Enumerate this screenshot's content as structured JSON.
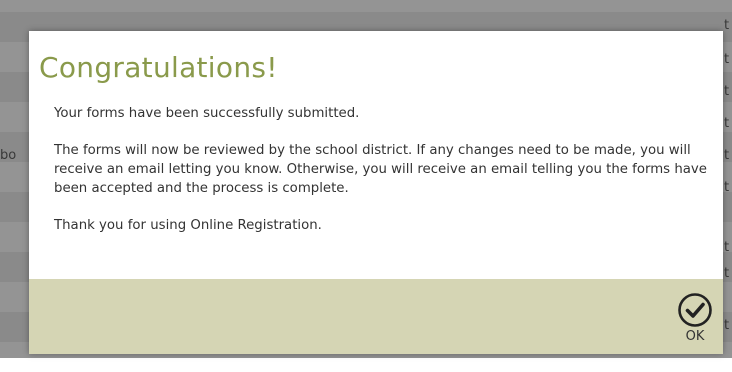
{
  "dialog": {
    "title": "Congratulations!",
    "paragraphs": [
      "Your forms have been successfully submitted.",
      "The forms will now be reviewed by the school district. If any changes need to be made, you will receive an email letting you know. Otherwise, you will receive an email telling you the forms have been accepted and the process is complete.",
      "Thank you for using Online Registration."
    ],
    "ok_label": "OK",
    "ok_icon": "check-circle-icon"
  },
  "background": {
    "left_fragment": "bo",
    "right_fragments": [
      "t",
      "t",
      "t",
      "t",
      "t",
      "t",
      "t",
      "t",
      "t"
    ]
  },
  "colors": {
    "title": "#8a9a4b",
    "footer": "#d5d5b4",
    "overlay": "rgba(60,60,60,0.55)"
  }
}
